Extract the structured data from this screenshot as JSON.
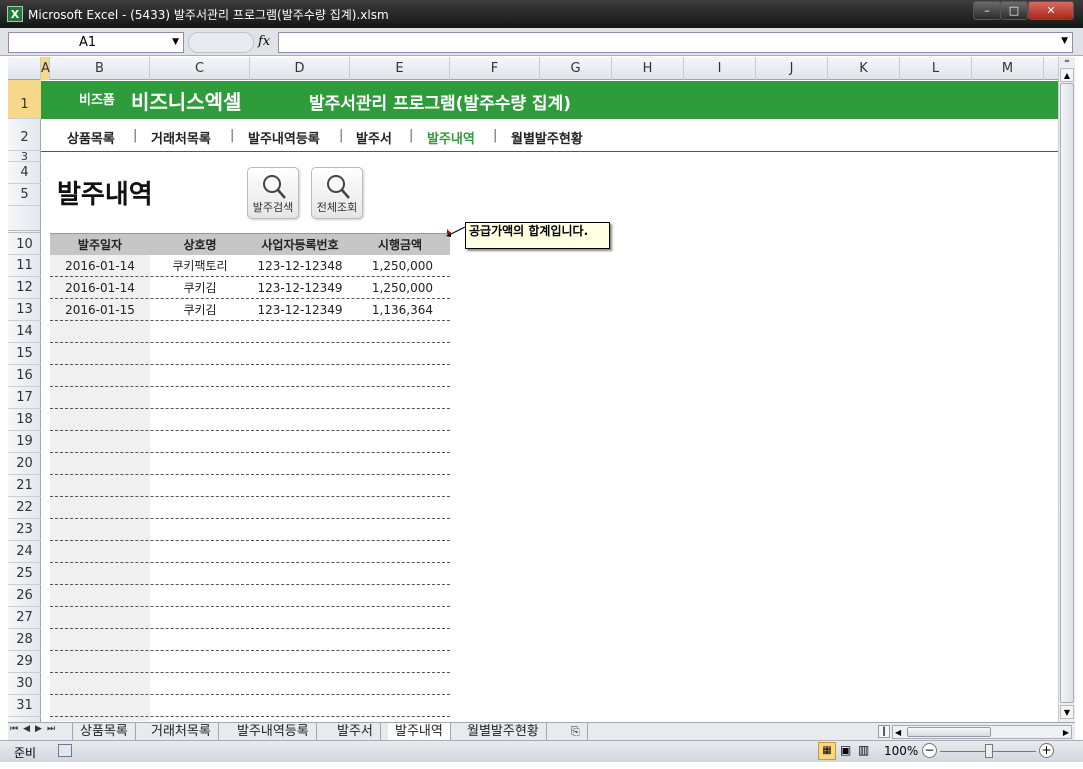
{
  "window": {
    "title": "Microsoft Excel - (5433) 발주서관리 프로그램(발주수량 집계).xlsm",
    "app_icon": "X",
    "minimize_icon": "minimize-icon",
    "maximize_icon": "maximize-icon",
    "close_icon": "close-icon"
  },
  "formula_bar": {
    "name_box": "A1",
    "fx": "fx",
    "value": ""
  },
  "columns": [
    "A",
    "B",
    "C",
    "D",
    "E",
    "F",
    "G",
    "H",
    "I",
    "J",
    "K",
    "L",
    "M"
  ],
  "rows": [
    "1",
    "2",
    "3",
    "4",
    "5",
    "10",
    "11",
    "12",
    "13",
    "14",
    "15",
    "16",
    "17",
    "18",
    "19",
    "20",
    "21",
    "22",
    "23",
    "24",
    "25",
    "26",
    "27",
    "28",
    "29",
    "30",
    "31"
  ],
  "banner": {
    "small_label": "비즈폼",
    "brand": "비즈니스엑셀",
    "title": "발주서관리 프로그램(발주수량 집계)",
    "color": "#2f9c3c"
  },
  "nav": {
    "items": [
      "상품목록",
      "거래처목록",
      "발주내역등록",
      "발주서",
      "발주내역",
      "월별발주현황"
    ],
    "separator": "|",
    "active_index": 4,
    "active_color": "#2f9c3c"
  },
  "page": {
    "heading": "발주내역",
    "buttons": [
      {
        "label": "발주검색",
        "icon": "search-icon"
      },
      {
        "label": "전체조회",
        "icon": "search-icon"
      }
    ]
  },
  "table": {
    "headers": [
      "발주일자",
      "상호명",
      "사업자등록번호",
      "시행금액"
    ],
    "rows": [
      [
        "2016-01-14",
        "쿠키팩토리",
        "123-12-12348",
        "1,250,000"
      ],
      [
        "2016-01-14",
        "쿠키김",
        "123-12-12349",
        "1,250,000"
      ],
      [
        "2016-01-15",
        "쿠키김",
        "123-12-12349",
        "1,136,364"
      ],
      [
        "",
        "",
        "",
        ""
      ],
      [
        "",
        "",
        "",
        ""
      ],
      [
        "",
        "",
        "",
        ""
      ],
      [
        "",
        "",
        "",
        ""
      ],
      [
        "",
        "",
        "",
        ""
      ],
      [
        "",
        "",
        "",
        ""
      ],
      [
        "",
        "",
        "",
        ""
      ],
      [
        "",
        "",
        "",
        ""
      ],
      [
        "",
        "",
        "",
        ""
      ],
      [
        "",
        "",
        "",
        ""
      ],
      [
        "",
        "",
        "",
        ""
      ],
      [
        "",
        "",
        "",
        ""
      ],
      [
        "",
        "",
        "",
        ""
      ],
      [
        "",
        "",
        "",
        ""
      ],
      [
        "",
        "",
        "",
        ""
      ],
      [
        "",
        "",
        "",
        ""
      ],
      [
        "",
        "",
        "",
        ""
      ],
      [
        "",
        "",
        "",
        ""
      ]
    ]
  },
  "comment": {
    "text": "공급가액의 합계입니다."
  },
  "sheet_tabs": [
    "상품목록",
    "거래처목록",
    "발주내역등록",
    "발주서",
    "발주내역",
    "월별발주현황"
  ],
  "active_sheet": 4,
  "status": {
    "ready": "준비",
    "zoom": "100%"
  }
}
